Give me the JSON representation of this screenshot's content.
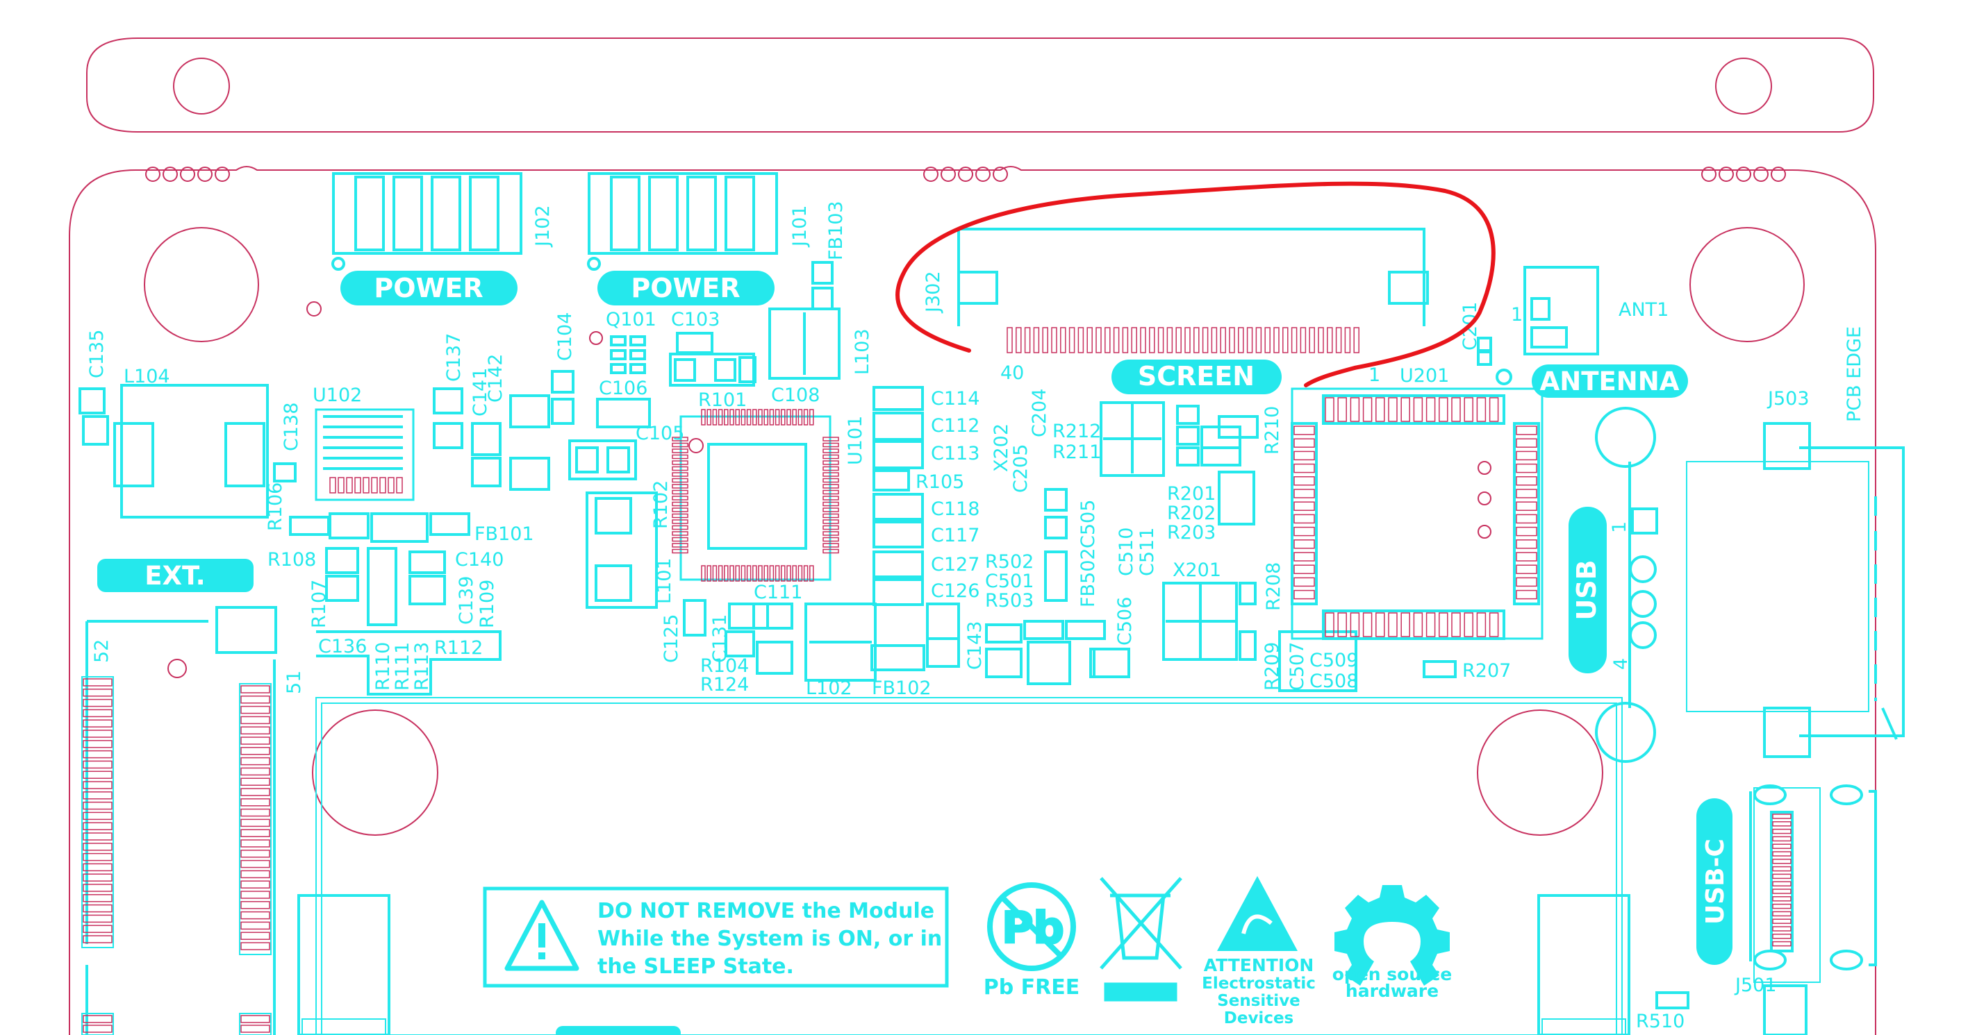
{
  "colors": {
    "silkscreen": "#25e8ec",
    "outline": "#c8315f",
    "annotation": "#e8151b",
    "background": "#ffffff"
  },
  "badges": {
    "power_left": "POWER",
    "power_right": "POWER",
    "screen": "SCREEN",
    "antenna": "ANTENNA",
    "ext": "EXT.",
    "usb": "USB",
    "usb_c": "USB-C"
  },
  "connectors": {
    "j102": "J102",
    "j101": "J101",
    "j302": "J302",
    "j503": "J503",
    "j501": "J501",
    "ant1": "ANT1",
    "pcb_edge": "PCB EDGE",
    "pin_40": "40",
    "pin_1_screen": "1",
    "pin_1_ant": "1",
    "pin_1_usb": "1",
    "pin_4_usb": "4",
    "pin_52": "52",
    "pin_51": "51"
  },
  "parts": {
    "q101": "Q101",
    "c103": "C103",
    "fb103": "FB103",
    "l103": "L103",
    "c135": "C135",
    "l104": "L104",
    "u102": "U102",
    "c137": "C137",
    "c142": "C142",
    "c104": "C104",
    "c141": "C141",
    "c138": "C138",
    "c106": "C106",
    "c105": "C105",
    "r101": "R101",
    "c108": "C108",
    "r102": "R102",
    "u101": "U101",
    "l101": "L101",
    "fb101": "FB101",
    "r106": "R106",
    "r108": "R108",
    "c140": "C140",
    "r107": "R107",
    "c139": "C139",
    "r109": "R109",
    "r110": "R110",
    "r111": "R111",
    "r113": "R113",
    "r112": "R112",
    "c136": "C136",
    "c114": "C114",
    "c112": "C112",
    "c113": "C113",
    "r105": "R105",
    "c118": "C118",
    "c117": "C117",
    "c127": "C127",
    "c126": "C126",
    "c111": "C111",
    "c125": "C125",
    "c131": "C131",
    "r104": "R104",
    "r124": "R124",
    "c143": "C143",
    "l102": "L102",
    "fb102": "FB102",
    "x202": "X202",
    "c205": "C205",
    "c204": "C204",
    "r212": "R212",
    "r211": "R211",
    "c505": "C505",
    "r210": "R210",
    "r201": "R201",
    "r202": "R202",
    "r203": "R203",
    "r502": "R502",
    "c501": "C501",
    "r503": "R503",
    "fb502": "FB502",
    "c510": "C510",
    "c511": "C511",
    "c506": "C506",
    "x201": "X201",
    "r208": "R208",
    "r209": "R209",
    "c507": "C507",
    "c509": "C509",
    "c508": "C508",
    "r207": "R207",
    "c201": "C201",
    "u201": "U201",
    "r510": "R510"
  },
  "warning": {
    "line1": "DO NOT REMOVE the Module",
    "line2": "While the System is ON, or in",
    "line3": "the SLEEP State."
  },
  "logos": {
    "pb_free": "Pb FREE",
    "pb_symbol": "Pb",
    "esd_line1": "ATTENTION",
    "esd_line2": "Electrostatic",
    "esd_line3": "Sensitive",
    "esd_line4": "Devices",
    "osh_line1": "open source",
    "osh_line2": "hardware"
  }
}
